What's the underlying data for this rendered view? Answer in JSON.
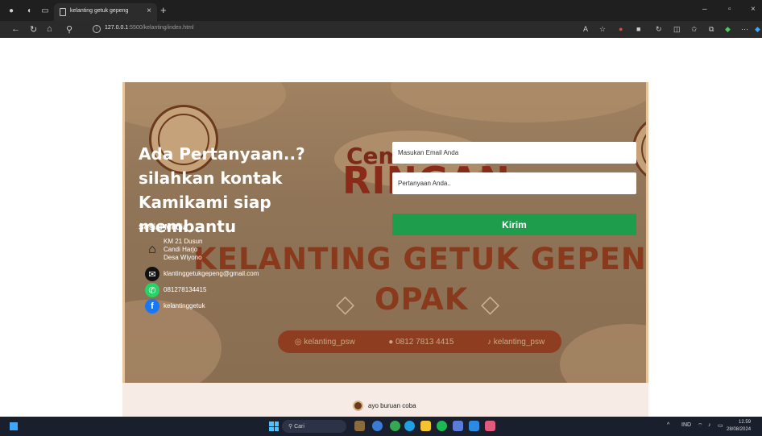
{
  "browser": {
    "tab_title": "kelanting getuk gepeng",
    "tab_close": "×",
    "new_tab": "+",
    "url_host": "127.0.0.1",
    "url_rest": ":5500/kelanting/index.html",
    "win_min": "–",
    "win_max": "▫",
    "win_close": "×"
  },
  "hero_art": {
    "cemil": "Cemil",
    "ringan": "RINGAN",
    "brand_line1": "KELANTING GETUK GEPENG &",
    "brand_line2": "OPAK",
    "diamond": "◇",
    "social_instagram": "◎ kelanting_psw",
    "social_phone": "● 0812 7813 4415",
    "social_tiktok": "♪ kelanting_psw"
  },
  "contact": {
    "heading": "Ada Pertanyaan..? silahkan kontak Kamikami siap membantu",
    "social_title": "Sosial Media",
    "address": [
      "KM 21 Dusun",
      "Candi Harjo",
      "Desa Wiyono"
    ],
    "email": "klantinggetukgepeng@gmail.com",
    "phone": "081278134415",
    "facebook": "kelantinggetuk"
  },
  "form": {
    "email_placeholder": "Masukan Email Anda",
    "question_placeholder": "Pertanyaan Anda..",
    "submit_label": "Kirim"
  },
  "footer": {
    "text": "ayo buruan coba"
  },
  "taskbar": {
    "search_label": "Cari",
    "lang": "IND",
    "time": "12.59",
    "date": "28/08/2024"
  },
  "colors": {
    "accent_green": "#1e9e4c",
    "hero_brown": "#907457",
    "brand_red": "#8a3a1c",
    "footer_bg": "#f7ebe5"
  }
}
